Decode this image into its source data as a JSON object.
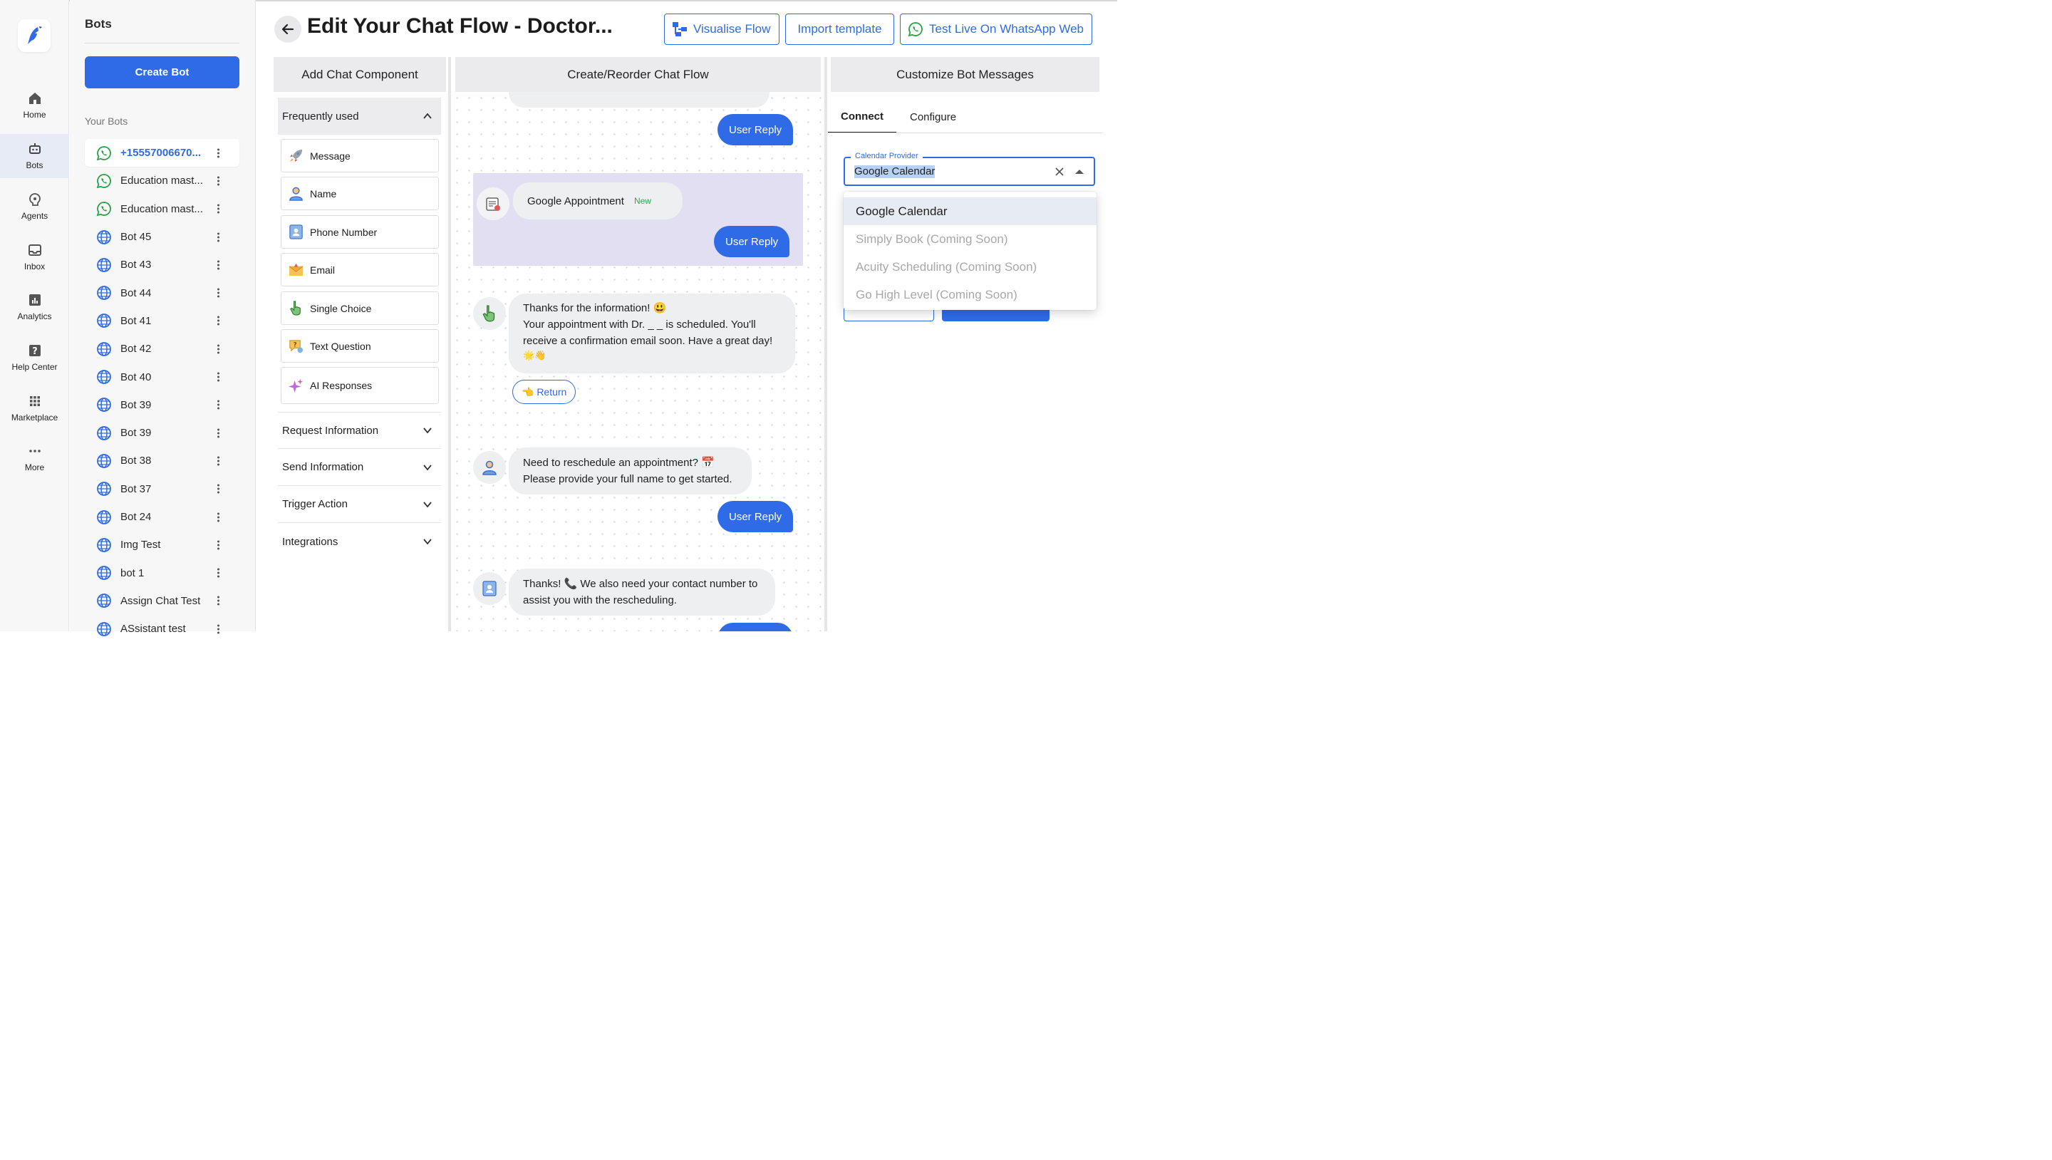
{
  "nav": {
    "items": [
      {
        "label": "Home",
        "icon": "home-icon"
      },
      {
        "label": "Bots",
        "icon": "bot-icon",
        "active": true
      },
      {
        "label": "Agents",
        "icon": "agents-icon"
      },
      {
        "label": "Inbox",
        "icon": "inbox-icon"
      },
      {
        "label": "Analytics",
        "icon": "analytics-icon"
      },
      {
        "label": "Help Center",
        "icon": "help-icon"
      },
      {
        "label": "Marketplace",
        "icon": "marketplace-icon"
      },
      {
        "label": "More",
        "icon": "more-icon"
      }
    ]
  },
  "sidebar": {
    "title": "Bots",
    "create_label": "Create Bot",
    "section_label": "Your Bots",
    "bots": [
      {
        "name": "+15557006670...",
        "type": "whatsapp",
        "selected": true
      },
      {
        "name": "Education mast...",
        "type": "whatsapp"
      },
      {
        "name": "Education mast...",
        "type": "whatsapp"
      },
      {
        "name": "Bot 45",
        "type": "web"
      },
      {
        "name": "Bot 43",
        "type": "web"
      },
      {
        "name": "Bot 44",
        "type": "web"
      },
      {
        "name": "Bot 41",
        "type": "web"
      },
      {
        "name": "Bot 42",
        "type": "web"
      },
      {
        "name": "Bot 40",
        "type": "web"
      },
      {
        "name": "Bot 39",
        "type": "web"
      },
      {
        "name": "Bot 39",
        "type": "web"
      },
      {
        "name": "Bot 38",
        "type": "web"
      },
      {
        "name": "Bot 37",
        "type": "web"
      },
      {
        "name": "Bot 24",
        "type": "web"
      },
      {
        "name": "Img Test",
        "type": "web"
      },
      {
        "name": "bot 1",
        "type": "web"
      },
      {
        "name": "Assign Chat Test",
        "type": "web"
      },
      {
        "name": "ASsistant test",
        "type": "web"
      }
    ]
  },
  "header": {
    "title": "Edit Your Chat Flow - Doctor...",
    "visualise_label": "Visualise Flow",
    "import_label": "Import template",
    "test_label": "Test Live On WhatsApp Web"
  },
  "columns": {
    "add": "Add Chat Component",
    "flow": "Create/Reorder Chat Flow",
    "customize": "Customize Bot Messages"
  },
  "components": {
    "frequent_label": "Frequently used",
    "items": [
      {
        "label": "Message",
        "icon": "rocket-icon"
      },
      {
        "label": "Name",
        "icon": "person-icon"
      },
      {
        "label": "Phone Number",
        "icon": "contact-card-icon"
      },
      {
        "label": "Email",
        "icon": "envelope-icon"
      },
      {
        "label": "Single Choice",
        "icon": "pointing-hand-icon"
      },
      {
        "label": "Text Question",
        "icon": "question-bubble-icon"
      },
      {
        "label": "AI Responses",
        "icon": "sparkles-icon"
      }
    ],
    "sections": [
      "Request Information",
      "Send Information",
      "Trigger Action",
      "Integrations"
    ]
  },
  "flow": {
    "user_reply": "User Reply",
    "appointment_label": "Google Appointment",
    "new_badge": "New",
    "thanks_line1": "Thanks for the information! 😃",
    "thanks_line2": "Your appointment with Dr. _ _ is scheduled. You'll",
    "thanks_line3": "receive a confirmation email soon. Have a great day!",
    "thanks_line4": "🌟👋",
    "return_label": "👈 Return",
    "resched_line1": "Need to reschedule an appointment? 📅",
    "resched_line2": "Please provide your full name to get started.",
    "contact_line1": "Thanks! 📞 We also need your contact number to",
    "contact_line2": "assist you with the rescheduling."
  },
  "customize": {
    "tabs": [
      "Connect",
      "Configure"
    ],
    "active_tab": "Connect",
    "field_label": "Calendar Provider",
    "field_value": "Google Calendar",
    "options": [
      {
        "label": "Google Calendar",
        "selected": true
      },
      {
        "label": "Simply Book (Coming Soon)",
        "disabled": true
      },
      {
        "label": "Acuity Scheduling (Coming Soon)",
        "disabled": true
      },
      {
        "label": "Go High Level (Coming Soon)",
        "disabled": true
      }
    ]
  },
  "colors": {
    "primary": "#2f6be6",
    "whatsapp": "#25a244",
    "highlight": "#e3dff3",
    "new_badge": "#2ea44f"
  }
}
